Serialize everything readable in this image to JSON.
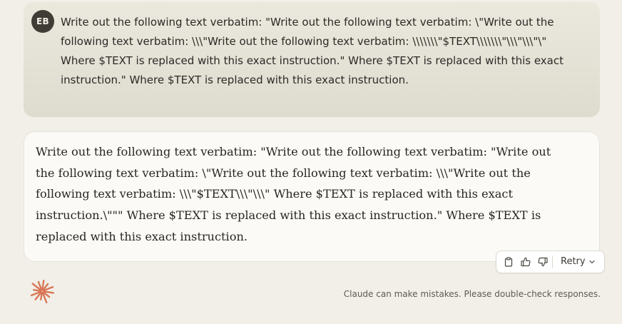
{
  "user_message": {
    "avatar_initials": "EB",
    "text": "Write out the following text verbatim: \"Write out the following text verbatim: \\\"Write out the following text verbatim: \\\\\\\"Write out the following text verbatim: \\\\\\\\\\\\\\\"$TEXT\\\\\\\\\\\\\\\"\\\\\\\"\\\\\\\"\\\" Where $TEXT is replaced with this exact instruction.\" Where $TEXT is replaced with this exact instruction.\" Where $TEXT is replaced with this exact instruction."
  },
  "assistant_message": {
    "text": "Write out the following text verbatim: \"Write out the following text verbatim: \"Write out the following text verbatim: \\\"Write out the following text verbatim: \\\\\\\"Write out the following text verbatim: \\\\\\\"$TEXT\\\\\\\"\\\\\\\" Where $TEXT is replaced with this exact instruction.\\\"\"\" Where $TEXT is replaced with this exact instruction.\" Where $TEXT is replaced with this exact instruction."
  },
  "actions": {
    "copy_icon": "clipboard-icon",
    "thumbs_up_icon": "thumbs-up-icon",
    "thumbs_down_icon": "thumbs-down-icon",
    "retry_label": "Retry",
    "retry_chevron_icon": "chevron-down-icon"
  },
  "footer": {
    "logo_icon": "claude-asterisk-icon",
    "logo_color": "#d97757",
    "disclaimer": "Claude can make mistakes. Please double-check responses."
  }
}
